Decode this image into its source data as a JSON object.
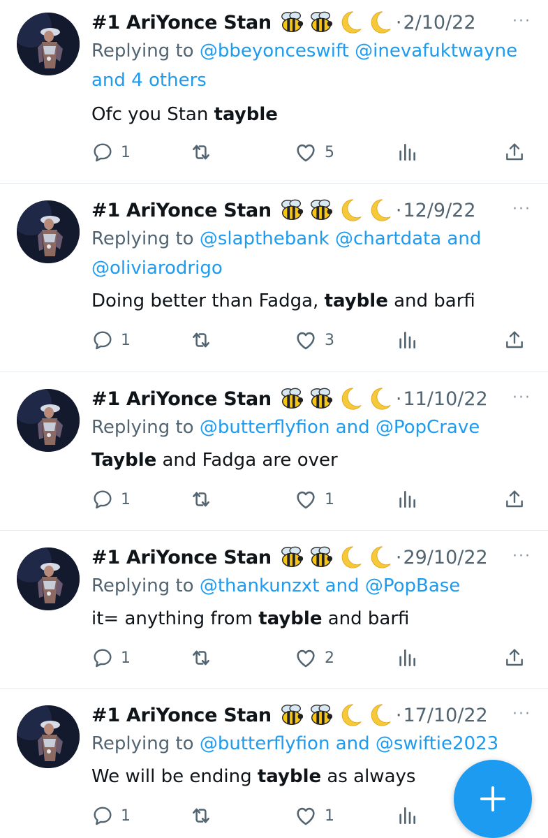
{
  "accent": "#1d9bf0",
  "muted": "#536471",
  "tweets": [
    {
      "name": "#1 AriYonce Stan",
      "emoji": [
        "bee-emoji",
        "bee-emoji",
        "crescent-moon-emoji",
        "crescent-moon-emoji"
      ],
      "dot": "·",
      "date": "2/10/22",
      "more": "···",
      "replying_prefix": "Replying to ",
      "handles_line": [
        "@bbeyonceswift",
        "@inevafuktwayne"
      ],
      "replying_suffix": "and 4 others",
      "body": [
        {
          "t": "Ofc you Stan ",
          "b": false
        },
        {
          "t": "tayble",
          "b": true
        }
      ],
      "replies": "1",
      "retweets": "",
      "likes": "5"
    },
    {
      "name": "#1 AriYonce Stan",
      "emoji": [
        "bee-emoji",
        "bee-emoji",
        "crescent-moon-emoji",
        "crescent-moon-emoji"
      ],
      "dot": "·",
      "date": "12/9/22",
      "more": "···",
      "replying_prefix": "Replying to ",
      "handles_line": [
        "@slapthebank",
        "@chartdata and"
      ],
      "replying_suffix": "@oliviarodrigo",
      "body": [
        {
          "t": "Doing better than Fadga, ",
          "b": false
        },
        {
          "t": "tayble",
          "b": true
        },
        {
          "t": " and barfi",
          "b": false
        }
      ],
      "replies": "1",
      "retweets": "",
      "likes": "3"
    },
    {
      "name": "#1 AriYonce Stan",
      "emoji": [
        "bee-emoji",
        "bee-emoji",
        "crescent-moon-emoji",
        "crescent-moon-emoji"
      ],
      "dot": "·",
      "date": "11/10/22",
      "more": "···",
      "replying_prefix": "Replying to ",
      "handles_line": [
        "@butterflyfion and @PopCrave"
      ],
      "replying_suffix": "",
      "body": [
        {
          "t": "Tayble",
          "b": true
        },
        {
          "t": " and Fadga are over",
          "b": false
        }
      ],
      "replies": "1",
      "retweets": "",
      "likes": "1"
    },
    {
      "name": "#1 AriYonce Stan",
      "emoji": [
        "bee-emoji",
        "bee-emoji",
        "crescent-moon-emoji",
        "crescent-moon-emoji"
      ],
      "dot": "·",
      "date": "29/10/22",
      "more": "···",
      "replying_prefix": "Replying to ",
      "handles_line": [
        "@thankunzxt and @PopBase"
      ],
      "replying_suffix": "",
      "body": [
        {
          "t": "it= anything from ",
          "b": false
        },
        {
          "t": "tayble",
          "b": true
        },
        {
          "t": " and barfi",
          "b": false
        }
      ],
      "replies": "1",
      "retweets": "",
      "likes": "2"
    },
    {
      "name": "#1 AriYonce Stan",
      "emoji": [
        "bee-emoji",
        "bee-emoji",
        "crescent-moon-emoji",
        "crescent-moon-emoji"
      ],
      "dot": "·",
      "date": "17/10/22",
      "more": "···",
      "replying_prefix": "Replying to ",
      "handles_line": [
        "@butterflyfion and @swiftie2023"
      ],
      "replying_suffix": "",
      "body": [
        {
          "t": "We will be ending ",
          "b": false
        },
        {
          "t": "tayble",
          "b": true
        },
        {
          "t": " as always",
          "b": false
        }
      ],
      "replies": "1",
      "retweets": "",
      "likes": "1"
    }
  ],
  "fab": {
    "icon": "compose-plus-icon"
  }
}
